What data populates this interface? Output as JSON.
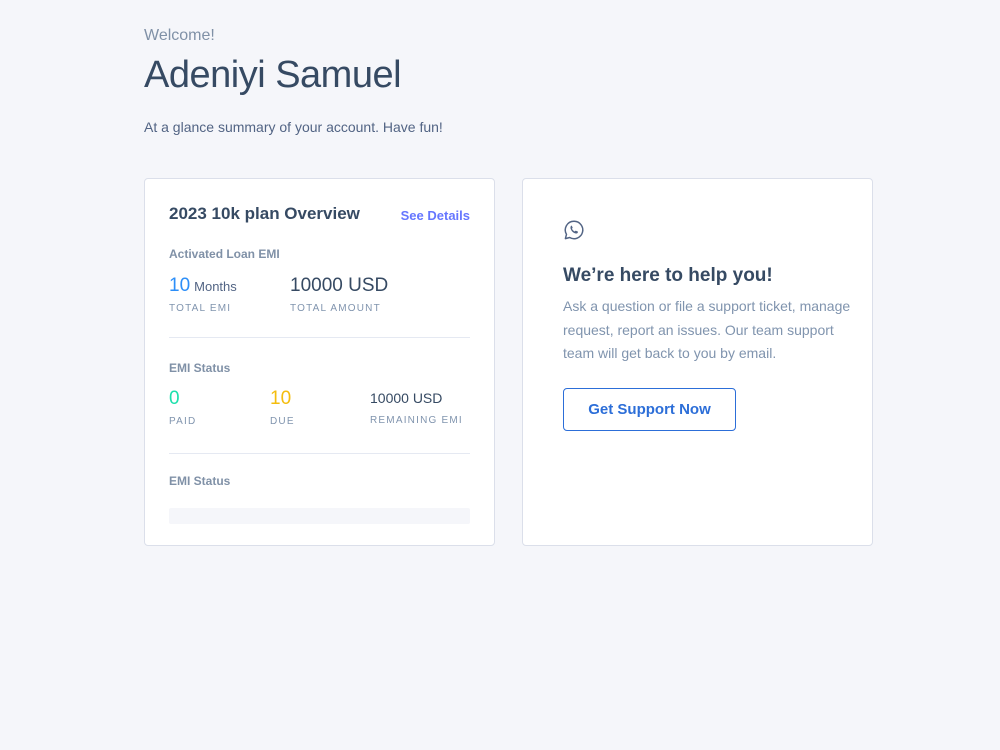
{
  "header": {
    "welcome": "Welcome!",
    "name": "Adeniyi Samuel",
    "summary": "At a glance summary of your account. Have fun!"
  },
  "plan_card": {
    "title": "2023 10k plan Overview",
    "see_details": "See Details",
    "loan_section_label": "Activated Loan EMI",
    "total_emi": {
      "value": "10",
      "unit": "Months",
      "label": "TOTAL EMI"
    },
    "total_amount": {
      "value": "10000 USD",
      "label": "TOTAL AMOUNT"
    },
    "status_section_label": "EMI Status",
    "paid": {
      "value": "0",
      "label": "PAID"
    },
    "due": {
      "value": "10",
      "label": "DUE"
    },
    "remaining": {
      "value": "10000 USD",
      "label": "REMAINING EMI"
    },
    "progress_section_label": "EMI Status",
    "progress_fraction": 0
  },
  "support_card": {
    "icon": "whatsapp-icon",
    "title": "We’re here to help you!",
    "text": "Ask a question or file a support ticket, manage request, report an issues. Our team support team will get back to you by email.",
    "button_label": "Get Support Now"
  },
  "colors": {
    "background": "#f5f6fa",
    "accent_blue": "#2c8ef8",
    "paid_green": "#1ee0ac",
    "due_orange": "#f4bd0e",
    "link": "#6576ff"
  }
}
